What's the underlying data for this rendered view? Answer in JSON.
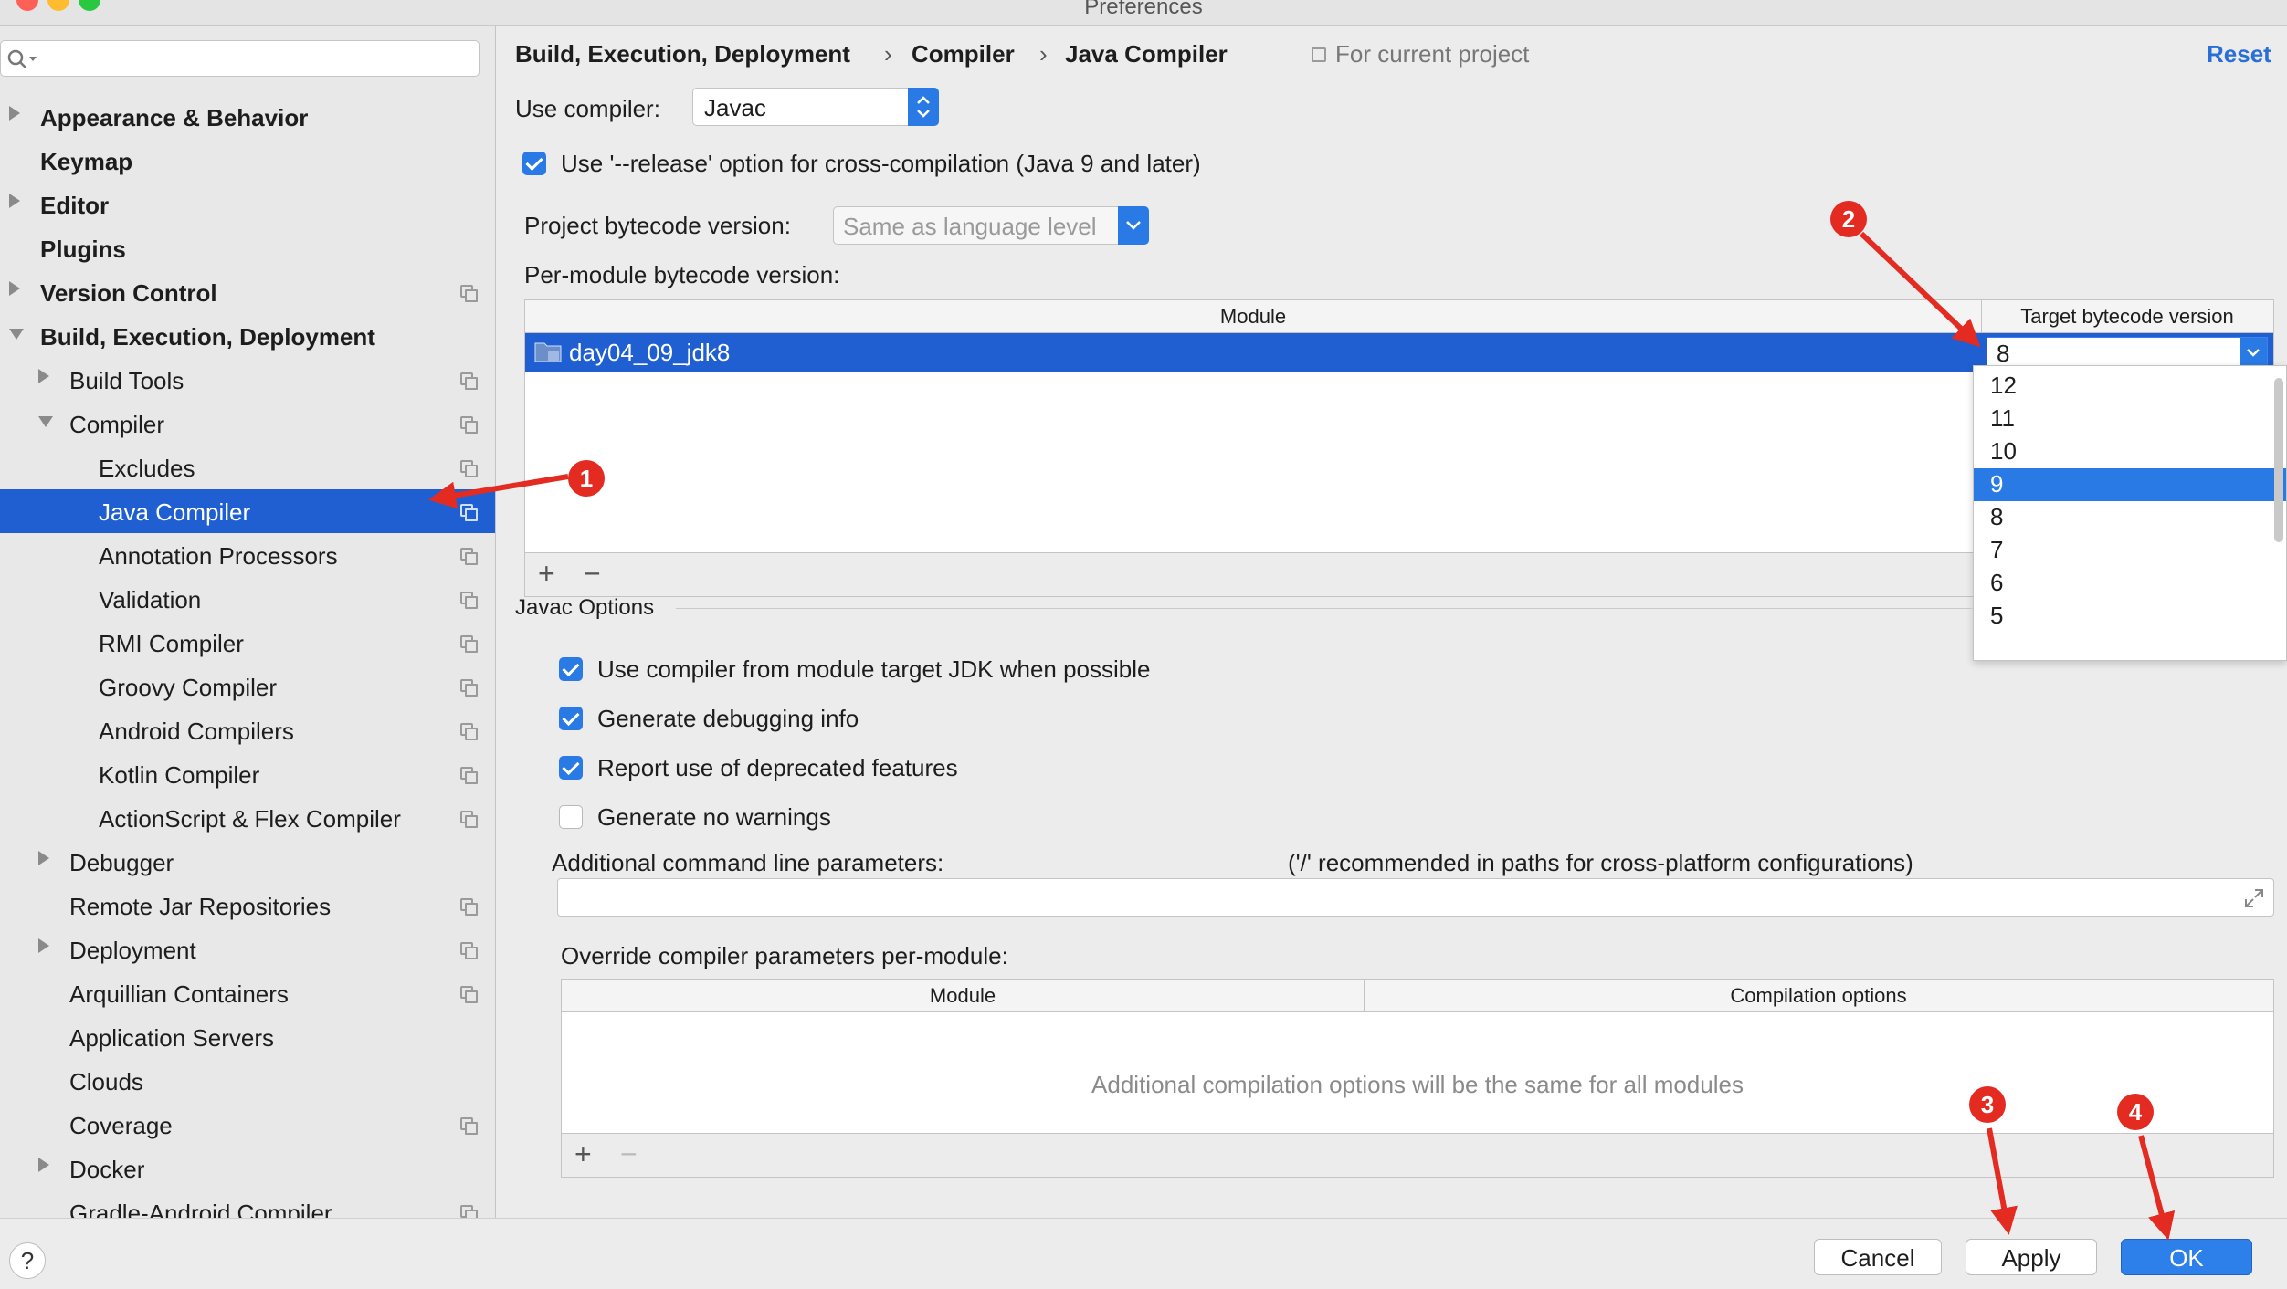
{
  "window": {
    "title": "Preferences"
  },
  "sidebar": {
    "items": [
      {
        "label": "Appearance & Behavior",
        "bold": true,
        "arrow": "right",
        "proj": false
      },
      {
        "label": "Keymap",
        "bold": true,
        "arrow": "none",
        "proj": false
      },
      {
        "label": "Editor",
        "bold": true,
        "arrow": "right",
        "proj": false
      },
      {
        "label": "Plugins",
        "bold": true,
        "arrow": "none",
        "proj": false
      },
      {
        "label": "Version Control",
        "bold": true,
        "arrow": "right",
        "proj": true
      },
      {
        "label": "Build, Execution, Deployment",
        "bold": true,
        "arrow": "down",
        "proj": false
      },
      {
        "label": "Build Tools",
        "bold": false,
        "arrow": "right",
        "proj": true
      },
      {
        "label": "Compiler",
        "bold": false,
        "arrow": "down",
        "proj": true
      },
      {
        "label": "Excludes",
        "bold": false,
        "arrow": "none",
        "proj": true
      },
      {
        "label": "Java Compiler",
        "bold": false,
        "arrow": "none",
        "proj": true,
        "selected": true
      },
      {
        "label": "Annotation Processors",
        "bold": false,
        "arrow": "none",
        "proj": true
      },
      {
        "label": "Validation",
        "bold": false,
        "arrow": "none",
        "proj": true
      },
      {
        "label": "RMI Compiler",
        "bold": false,
        "arrow": "none",
        "proj": true
      },
      {
        "label": "Groovy Compiler",
        "bold": false,
        "arrow": "none",
        "proj": true
      },
      {
        "label": "Android Compilers",
        "bold": false,
        "arrow": "none",
        "proj": true
      },
      {
        "label": "Kotlin Compiler",
        "bold": false,
        "arrow": "none",
        "proj": true
      },
      {
        "label": "ActionScript & Flex Compiler",
        "bold": false,
        "arrow": "none",
        "proj": true
      },
      {
        "label": "Debugger",
        "bold": false,
        "arrow": "right",
        "proj": false
      },
      {
        "label": "Remote Jar Repositories",
        "bold": false,
        "arrow": "none",
        "proj": true
      },
      {
        "label": "Deployment",
        "bold": false,
        "arrow": "right",
        "proj": true
      },
      {
        "label": "Arquillian Containers",
        "bold": false,
        "arrow": "none",
        "proj": true
      },
      {
        "label": "Application Servers",
        "bold": false,
        "arrow": "none",
        "proj": false
      },
      {
        "label": "Clouds",
        "bold": false,
        "arrow": "none",
        "proj": false
      },
      {
        "label": "Coverage",
        "bold": false,
        "arrow": "none",
        "proj": true
      },
      {
        "label": "Docker",
        "bold": false,
        "arrow": "right",
        "proj": false
      },
      {
        "label": "Gradle-Android Compiler",
        "bold": false,
        "arrow": "none",
        "proj": true
      }
    ]
  },
  "header": {
    "crumb1": "Build, Execution, Deployment",
    "crumb2": "Compiler",
    "crumb3": "Java Compiler",
    "sep": "›",
    "scope": "For current project",
    "reset": "Reset"
  },
  "compiler": {
    "use_label": "Use compiler:",
    "value": "Javac",
    "release_label": "Use '--release' option for cross-compilation (Java 9 and later)",
    "release_checked": true
  },
  "bytecode": {
    "project_label": "Project bytecode version:",
    "project_value": "Same as language level",
    "per_module_label": "Per-module bytecode version:",
    "col_module": "Module",
    "col_target": "Target bytecode version",
    "row_module": "day04_09_jdk8",
    "row_target": "8",
    "options": [
      "12",
      "11",
      "10",
      "9",
      "8",
      "7",
      "6",
      "5"
    ],
    "highlighted_option": "9"
  },
  "javac": {
    "section_label": "Javac Options",
    "options": [
      {
        "label": "Use compiler from module target JDK when possible",
        "checked": true
      },
      {
        "label": "Generate debugging info",
        "checked": true
      },
      {
        "label": "Report use of deprecated features",
        "checked": true
      },
      {
        "label": "Generate no warnings",
        "checked": false
      }
    ],
    "additional_label": "Additional command line parameters:",
    "additional_hint": "('/' recommended in paths for cross-platform configurations)",
    "additional_value": "",
    "override_label": "Override compiler parameters per-module:",
    "override_col_module": "Module",
    "override_col_options": "Compilation options",
    "override_empty": "Additional compilation options will be the same for all modules"
  },
  "toolbar": {
    "add": "+",
    "remove": "−"
  },
  "footer": {
    "help": "?",
    "cancel": "Cancel",
    "apply": "Apply",
    "ok": "OK"
  },
  "annotations": {
    "m1": "1",
    "m2": "2",
    "m3": "3",
    "m4": "4",
    "color": "#e32b22"
  },
  "colors": {
    "accent": "#2a7ae5",
    "selection": "#1f5fd2",
    "annotation": "#e32b22"
  }
}
